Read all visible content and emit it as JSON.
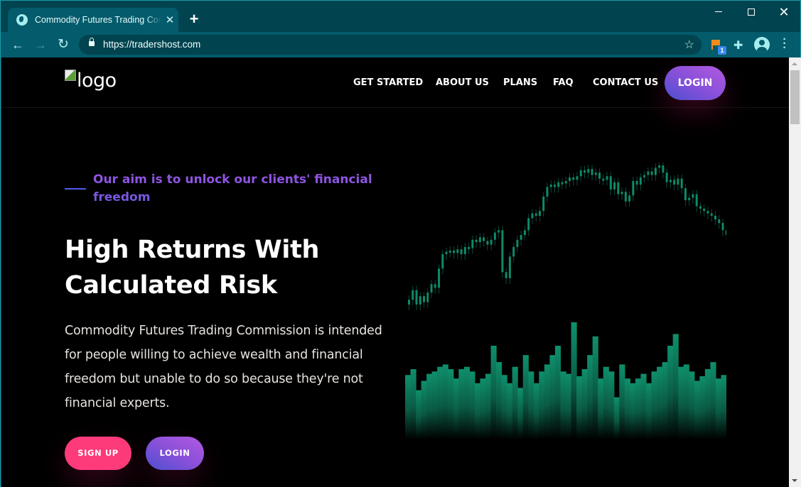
{
  "browser": {
    "tab_title": "Commodity Futures Trading Commission",
    "tab_icon": "globe-icon",
    "url": "https://tradershost.com",
    "extension_badge": "1",
    "icons": {
      "back": "arrow-left-icon",
      "forward": "arrow-right-icon",
      "reload": "reload-icon",
      "lock": "lock-icon",
      "bookmark": "star-icon",
      "extension_flag": "flag-icon",
      "extensions": "puzzle-icon",
      "profile": "avatar-icon",
      "menu": "kebab-menu-icon"
    },
    "glyphs": {
      "close": "✕",
      "new_tab": "+",
      "back": "←",
      "forward": "→",
      "reload": "↻",
      "star": "☆",
      "puzzle": "✚",
      "menu": "⋮",
      "win_close": "✕"
    }
  },
  "site": {
    "logo_alt": "logo",
    "nav": {
      "items": [
        "GET STARTED",
        "ABOUT US",
        "PLANS",
        "FAQ",
        "CONTACT US"
      ],
      "login": "LOGIN"
    },
    "hero": {
      "kicker": "Our aim is to unlock our clients' financial freedom",
      "title_line1": "High Returns With",
      "title_line2": "Calculated Risk",
      "description": "Commodity Futures Trading Commission is intended for people willing to achieve wealth and financial freedom but unable to do so because they're not financial experts.",
      "signup_label": "SIGN UP",
      "login_label": "LOGIN"
    },
    "colors": {
      "accent_pink": "#fd3b7a",
      "accent_purple": "#8a50d9",
      "chart_green": "#0f8f6c",
      "browser_frame": "#01444f"
    }
  },
  "decor_chart": {
    "type": "candlestick-volume",
    "description": "decorative market chart graphic",
    "closes": [
      22,
      30,
      18,
      25,
      20,
      28,
      35,
      32,
      48,
      60,
      62,
      63,
      61,
      64,
      60,
      66,
      65,
      72,
      70,
      74,
      71,
      68,
      72,
      78,
      80,
      45,
      40,
      58,
      66,
      72,
      76,
      80,
      90,
      94,
      92,
      96,
      108,
      116,
      118,
      116,
      120,
      119,
      121,
      124,
      122,
      125,
      130,
      128,
      131,
      126,
      128,
      123,
      122,
      125,
      114,
      120,
      110,
      112,
      104,
      109,
      121,
      118,
      124,
      126,
      129,
      126,
      132,
      134,
      128,
      120,
      122,
      118,
      123,
      115,
      105,
      107,
      110,
      100,
      98,
      96,
      94,
      92,
      89,
      86,
      80,
      76
    ],
    "volumes": [
      55,
      60,
      42,
      50,
      56,
      58,
      62,
      64,
      60,
      52,
      60,
      62,
      58,
      48,
      52,
      56,
      80,
      66,
      55,
      48,
      62,
      44,
      72,
      58,
      48,
      58,
      64,
      72,
      80,
      58,
      56,
      100,
      54,
      60,
      72,
      88,
      52,
      62,
      58,
      36,
      64,
      52,
      48,
      52,
      56,
      48,
      58,
      62,
      66,
      80,
      90,
      62,
      64,
      58,
      50,
      54,
      60,
      66,
      52,
      55
    ]
  }
}
